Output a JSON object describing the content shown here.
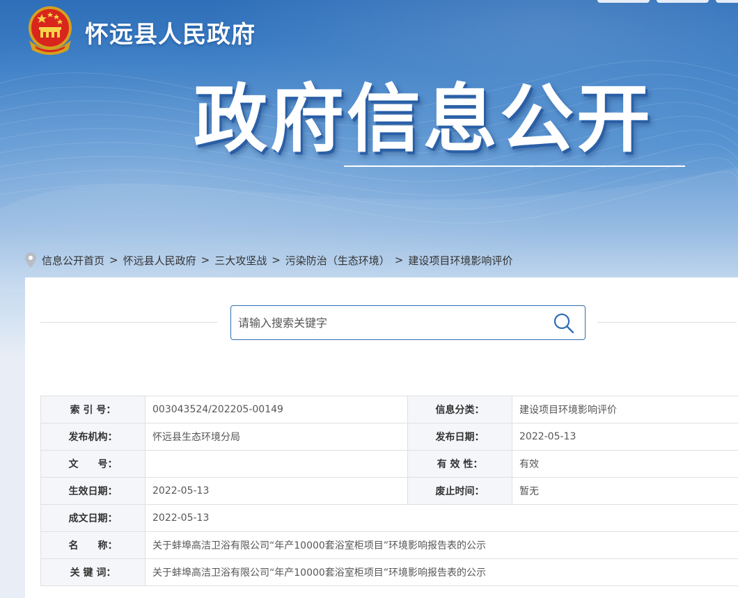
{
  "header": {
    "site_title": "怀远县人民政府",
    "hero_title": "政府信息公开"
  },
  "breadcrumb": {
    "items": [
      "信息公开首页",
      "怀远县人民政府",
      "三大攻坚战",
      "污染防治（生态环境）",
      "建设项目环境影响评价"
    ],
    "separator": ">"
  },
  "search": {
    "placeholder": "请输入搜索关键字"
  },
  "meta_table": {
    "index_no_label": "索 引 号：",
    "index_no": "003043524/202205-00149",
    "category_label": "信息分类：",
    "category": "建设项目环境影响评价",
    "publisher_label": "发布机构：",
    "publisher": "怀远县生态环境分局",
    "pub_date_label": "发布日期：",
    "pub_date": "2022-05-13",
    "doc_no_label": "文　　号：",
    "doc_no": "",
    "validity_label": "有 效 性：",
    "validity": "有效",
    "effective_date_label": "生效日期：",
    "effective_date": "2022-05-13",
    "expiry_label": "废止时间：",
    "expiry": "暂无",
    "written_date_label": "成文日期：",
    "written_date": "2022-05-13",
    "name_label": "名　　称：",
    "name": "关于蚌埠高洁卫浴有限公司“年产10000套浴室柜项目”环境影响报告表的公示",
    "keywords_label": "关 键 词：",
    "keywords": "关于蚌埠高洁卫浴有限公司“年产10000套浴室柜项目”环境影响报告表的公示"
  },
  "colors": {
    "banner_blue": "#3d7fc6",
    "search_border": "#2e6db4",
    "label_bg": "#f4f6f9"
  },
  "icons": [
    "national-emblem-icon",
    "location-pin-icon",
    "search-icon"
  ]
}
